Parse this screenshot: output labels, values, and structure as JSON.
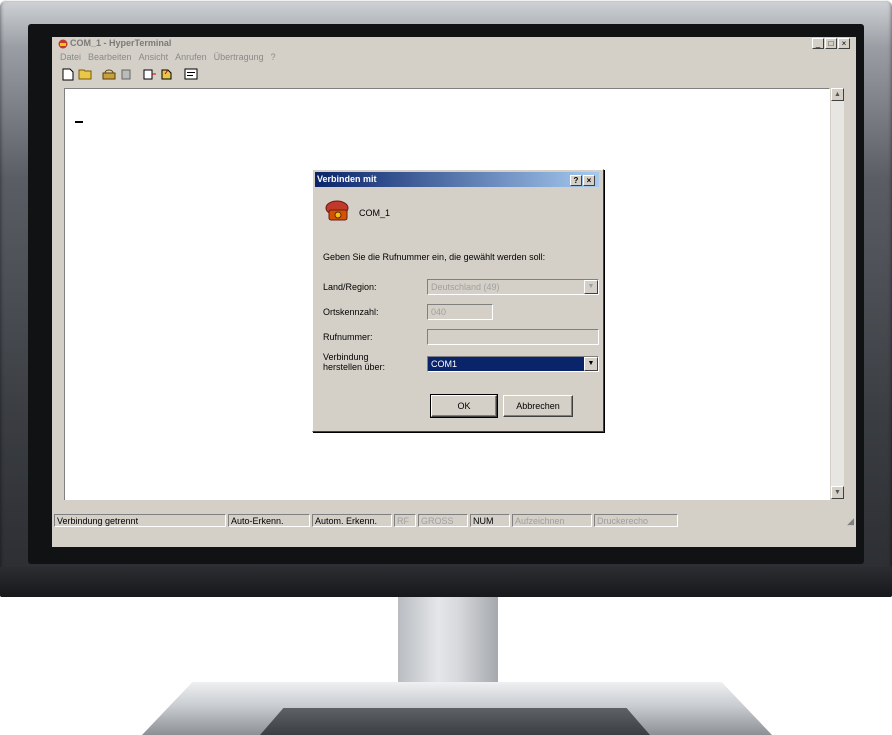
{
  "window": {
    "title": "COM_1 - HyperTerminal",
    "controls": [
      "_",
      "□",
      "×"
    ]
  },
  "menu": [
    "Datei",
    "Bearbeiten",
    "Ansicht",
    "Anrufen",
    "Übertragung",
    "?"
  ],
  "toolbar": [
    "new-icon",
    "open-icon",
    "connect-icon",
    "disconnect-icon",
    "send-icon",
    "receive-icon",
    "properties-icon"
  ],
  "terminal": {
    "cursor": "_"
  },
  "statusbar": {
    "connection": "Verbindung getrennt",
    "auto_detect": "Auto-Erkenn.",
    "auto_detect2": "Autom. Erkenn.",
    "rf": "RF",
    "caps": "GROSS",
    "num": "NUM",
    "capture": "Aufzeichnen",
    "print_echo": "Druckerecho"
  },
  "dialog": {
    "title": "Verbinden mit",
    "help": "?",
    "close": "×",
    "connection_name": "COM_1",
    "prompt": "Geben Sie die Rufnummer ein, die gewählt werden soll:",
    "country_label": "Land/Region:",
    "country_value": "Deutschland (49)",
    "area_label": "Ortskennzahl:",
    "area_value": "040",
    "phone_label": "Rufnummer:",
    "phone_value": "",
    "connect_label_1": "Verbindung",
    "connect_label_2": "herstellen über:",
    "connect_value": "COM1",
    "ok": "OK",
    "cancel": "Abbrechen"
  }
}
